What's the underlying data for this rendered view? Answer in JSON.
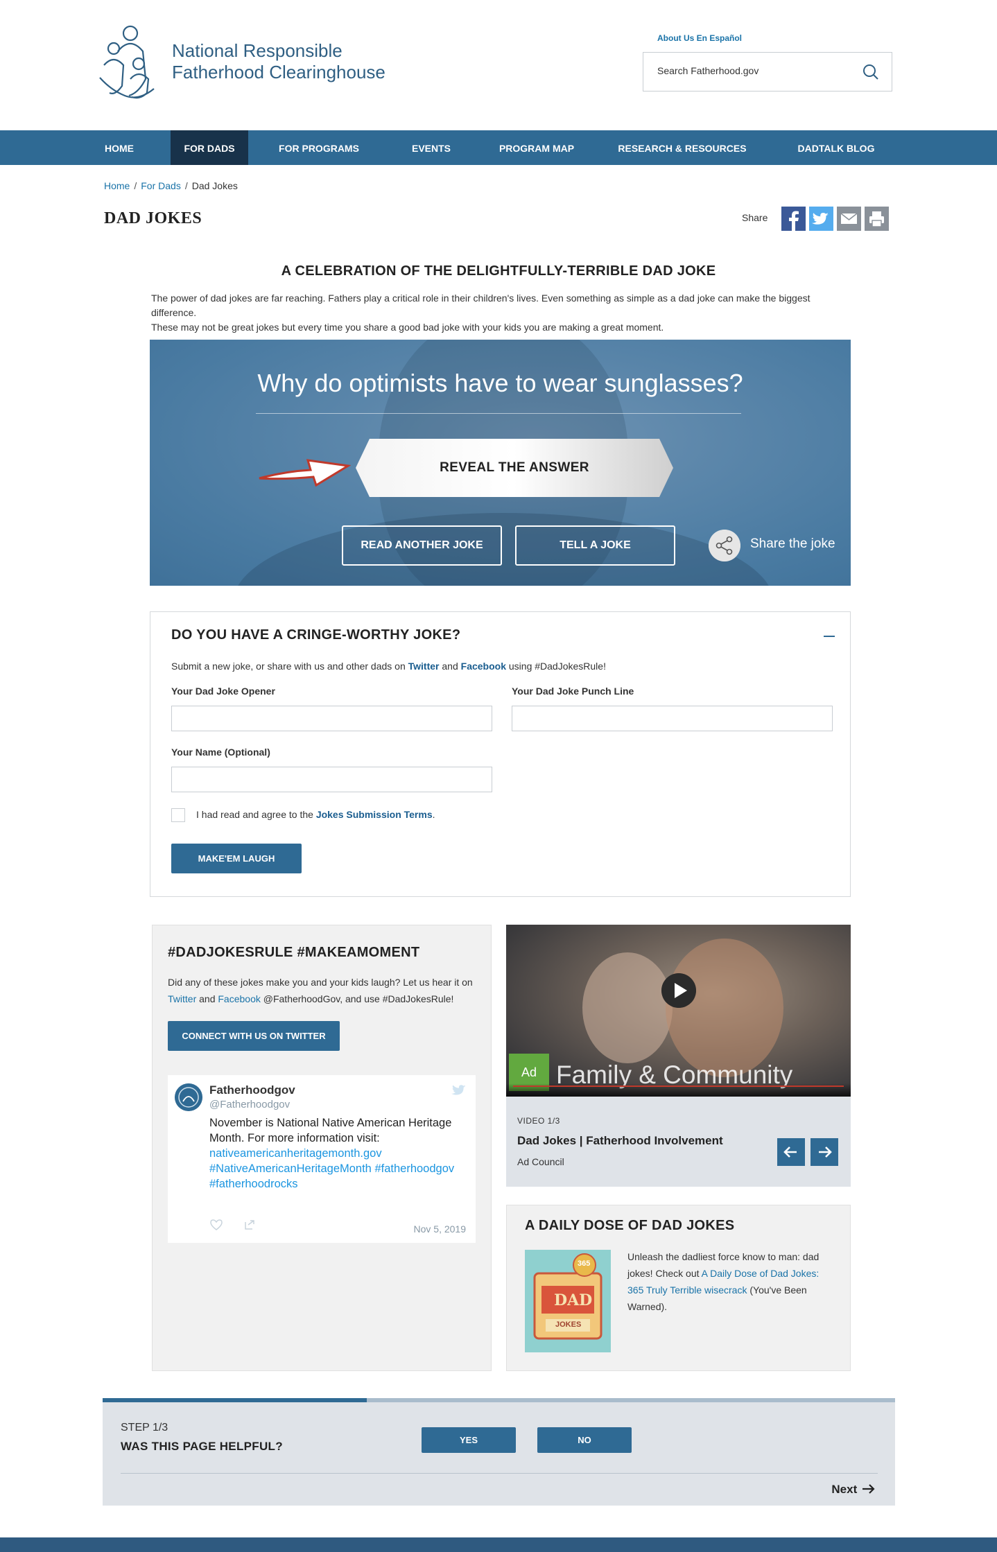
{
  "header": {
    "org_name_line1": "National Responsible",
    "org_name_line2": "Fatherhood Clearinghouse",
    "lang_link": "About Us En Español",
    "search_placeholder": "Search Fatherhood.gov"
  },
  "nav": {
    "items": [
      {
        "label": "HOME"
      },
      {
        "label": "FOR DADS"
      },
      {
        "label": "FOR PROGRAMS"
      },
      {
        "label": "EVENTS"
      },
      {
        "label": "PROGRAM MAP"
      },
      {
        "label": "RESEARCH & RESOURCES"
      },
      {
        "label": "DADTALK BLOG"
      }
    ],
    "active": "FOR DADS"
  },
  "breadcrumb": {
    "items": [
      "Home",
      "For Dads",
      "Dad Jokes"
    ],
    "separator": "/"
  },
  "page": {
    "title": "DAD JOKES",
    "share_label": "Share",
    "section_heading": "A CELEBRATION OF THE DELIGHTFULLY-TERRIBLE DAD JOKE",
    "intro_line1": "The power of dad jokes are far reaching. Fathers play a critical role in their children's lives. Even something as simple as a dad joke can make the biggest difference.",
    "intro_line2": "These may not be great jokes but every time you share a good bad joke with your kids you are making a great moment."
  },
  "share_icons": [
    "facebook-icon",
    "twitter-icon",
    "email-icon",
    "print-icon"
  ],
  "joke": {
    "question": "Why do optimists have to wear sunglasses?",
    "reveal_label": "REVEAL THE ANSWER",
    "read_another_label": "READ ANOTHER JOKE",
    "tell_label": "TELL A JOKE",
    "share_label": "Share the joke"
  },
  "submit": {
    "title": "DO YOU HAVE A CRINGE-WORTHY JOKE?",
    "desc_before": "Submit a new joke, or share with us and other dads on ",
    "desc_twitter": "Twitter",
    "desc_and": " and ",
    "desc_facebook": "Facebook",
    "desc_after": " using #DadJokesRule!",
    "opener_label": "Your Dad Joke Opener",
    "opener_value": "",
    "punch_label": "Your Dad Joke Punch Line",
    "punch_value": "",
    "name_label": "Your Name (Optional)",
    "name_value": "",
    "terms_before": "I had read and agree to the ",
    "terms_link": "Jokes Submission Terms",
    "terms_after": ".",
    "button_label": "MAKE'EM LAUGH"
  },
  "social": {
    "title": "#DADJOKESRULE #MAKEAMOMENT",
    "desc_before": "Did any of these jokes make you and your kids laugh? Let us hear it on",
    "desc_twitter": "Twitter",
    "desc_and": " and ",
    "desc_facebook": "Facebook",
    "desc_after": " @FatherhoodGov, and use #DadJokesRule!",
    "button_label": "CONNECT WITH US ON TWITTER",
    "tweet": {
      "name": "Fatherhoodgov",
      "handle": "@Fatherhoodgov",
      "text": "November is National Native American Heritage Month. For more information visit:",
      "link1": "nativeamericanheritagemonth.gov",
      "link2": "#NativeAmericanHeritageMonth #fatherhoodgov",
      "link3": "#fatherhoodrocks",
      "date": "Nov 5, 2019"
    }
  },
  "video": {
    "overlay_text": "Family & Community",
    "logo_text": "Ad",
    "counter": "VIDEO 1/3",
    "title": "Dad Jokes | Fatherhood Involvement",
    "source": "Ad Council"
  },
  "dose": {
    "title": "A DAILY DOSE OF DAD JOKES",
    "text_before": "Unleash the dadliest force know to man: dad jokes! Check out ",
    "link": "A Daily Dose of Dad Jokes: 365 Truly Terrible wisecrack",
    "text_after": " (You've Been Warned).",
    "book_title": "DAD",
    "book_sub": "JOKES",
    "book_badge": "365"
  },
  "feedback": {
    "step": "STEP 1/3",
    "question": "WAS THIS PAGE HELPFUL?",
    "yes_label": "YES",
    "no_label": "NO",
    "next_label": "Next",
    "progress": 0.333
  },
  "colors": {
    "brand_blue": "#2f6a94",
    "nav_active": "#18324a",
    "link": "#1a73a8"
  }
}
